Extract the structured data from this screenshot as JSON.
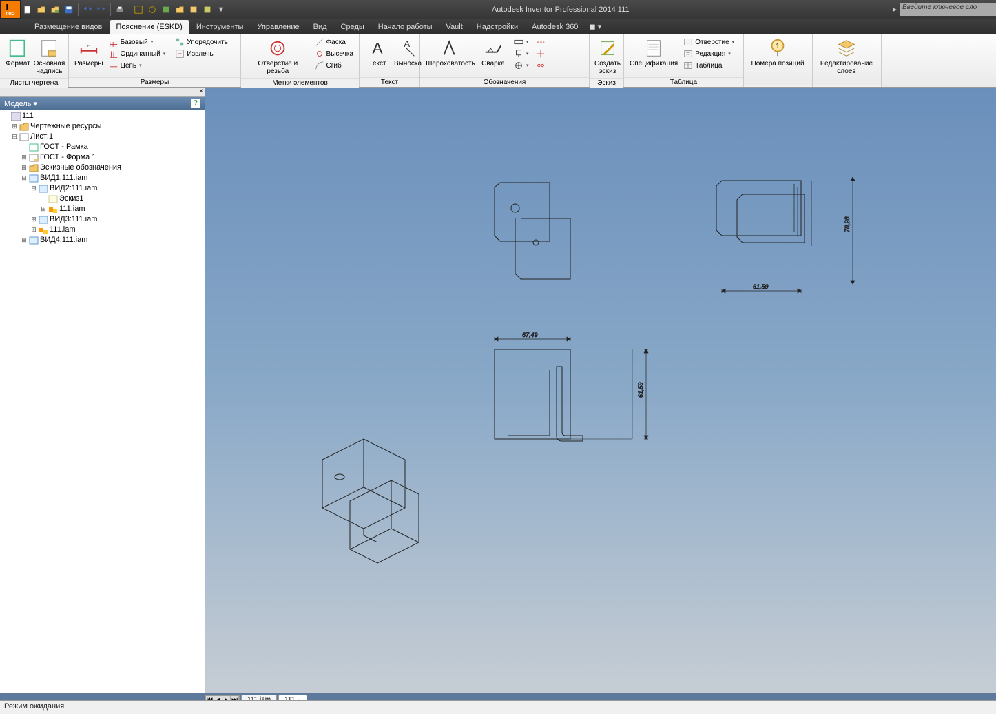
{
  "app": {
    "title": "Autodesk Inventor Professional 2014   111"
  },
  "search": {
    "placeholder": "Введите ключевое сло"
  },
  "tabs": {
    "items": [
      "Размещение видов",
      "Пояснение (ESKD)",
      "Инструменты",
      "Управление",
      "Вид",
      "Среды",
      "Начало работы",
      "Vault",
      "Надстройки",
      "Autodesk 360"
    ],
    "active_index": 1
  },
  "ribbon": {
    "panels": {
      "sheets": {
        "label": "Листы чертежа",
        "format": "Формат",
        "title_block": "Основная\nнадпись"
      },
      "dims": {
        "label": "Размеры",
        "sizes": "Размеры",
        "base": "Базовый",
        "ord": "Ординатный",
        "chain": "Цепь",
        "arrange": "Упорядочить",
        "retrieve": "Извлечь"
      },
      "marks": {
        "label": "Метки элементов",
        "hole_thread": "Отверстие и резьба",
        "chamfer": "Фаска",
        "punch": "Высечка",
        "bend": "Сгиб"
      },
      "text": {
        "label": "Текст",
        "text": "Текст",
        "leader": "Выноска"
      },
      "note": {
        "label": "Обозначения",
        "rough": "Шероховатость",
        "weld": "Сварка"
      },
      "sketch": {
        "label": "Эскиз",
        "create": "Создать\nэскиз"
      },
      "table": {
        "label": "Таблица",
        "spec": "Спецификация",
        "hole": "Отверстие",
        "rev": "Редакция",
        "tbl": "Таблица"
      },
      "balloon": {
        "label": "",
        "pos": "Номера позиций"
      },
      "layers": {
        "label": "",
        "edit": "Редактирование\nслоев"
      }
    }
  },
  "sidebar": {
    "title": "Модель",
    "tree": {
      "root": "111",
      "res": "Чертежные ресурсы",
      "sheet": "Лист:1",
      "gost_frame": "ГОСТ - Рамка",
      "gost_form": "ГОСТ - Форма 1",
      "sketch_sym": "Эскизные обозначения",
      "view1": "ВИД1:111.iam",
      "view2": "ВИД2:111.iam",
      "sketch1": "Эскиз1",
      "inner_iam": "111.iam",
      "view3": "ВИД3:111.iam",
      "iam": "111.iam",
      "view4": "ВИД4:111.iam"
    }
  },
  "dimensions": {
    "h1": "78,28",
    "w1": "61,59",
    "h2": "61,59",
    "w2": "67,49"
  },
  "doctabs": {
    "t1": "111.iam",
    "t2": "111"
  },
  "status": {
    "text": "Режим ожидания"
  }
}
